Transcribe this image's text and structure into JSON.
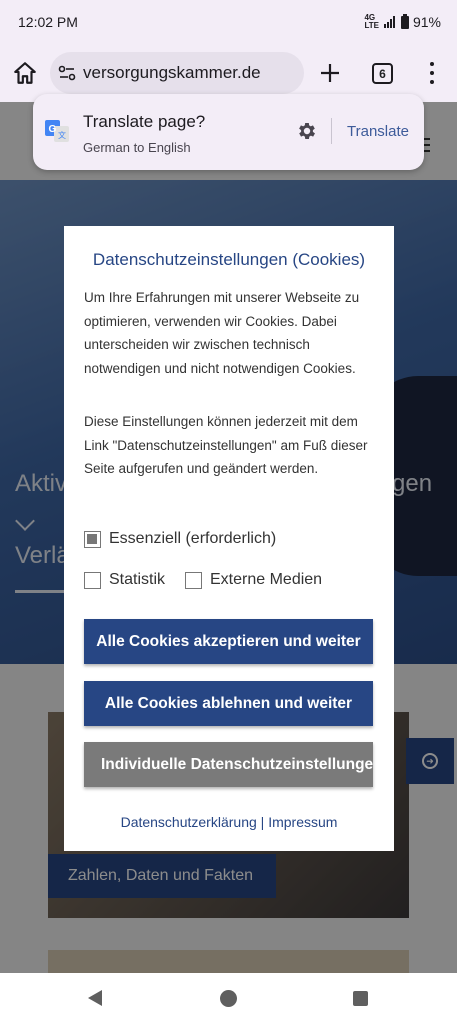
{
  "status_bar": {
    "time": "12:02 PM",
    "network": "4G LTE",
    "battery": "91%"
  },
  "browser": {
    "url": "versorgungskammer.de",
    "tab_count": "6",
    "icons": {
      "home": "home-icon",
      "site_info": "tune-icon",
      "new_tab": "plus-icon",
      "menu": "more-vert-icon"
    }
  },
  "translate_popup": {
    "title": "Translate page?",
    "subtitle": "German to English",
    "button": "Translate"
  },
  "page_background": {
    "hero_line1_left": "Aktiv",
    "hero_line1_right": "gen",
    "hero_line2": "Verlä",
    "card_label": "Zahlen, Daten und Fakten"
  },
  "cookie_dialog": {
    "title": "Datenschutzeinstellungen (Cookies)",
    "paragraph1": "Um Ihre Erfahrungen mit unserer Webseite zu optimieren, verwenden wir Cookies. Dabei unterscheiden wir zwischen technisch notwendigen und nicht notwendigen Cookies.",
    "paragraph2": "Diese Einstellungen können jederzeit mit dem Link \"Datenschutzeinstellungen\" am Fuß dieser Seite aufgerufen und geändert werden.",
    "options": {
      "essential": {
        "label": "Essenziell (erforderlich)",
        "checked": true,
        "disabled": true
      },
      "statistics": {
        "label": "Statistik",
        "checked": false
      },
      "external_media": {
        "label": "Externe Medien",
        "checked": false
      }
    },
    "buttons": {
      "accept_all": "Alle Cookies akzeptieren und weiter",
      "reject_all": "Alle Cookies ablehnen und weiter",
      "individual": "Individuelle Datenschutzeinstellungen"
    },
    "links": {
      "privacy": "Datenschutzerklärung",
      "separator": "|",
      "imprint": "Impressum"
    }
  },
  "colors": {
    "brand_blue": "#274684",
    "button_gray": "#7a7a7a",
    "browser_chrome": "#f3edf7"
  }
}
